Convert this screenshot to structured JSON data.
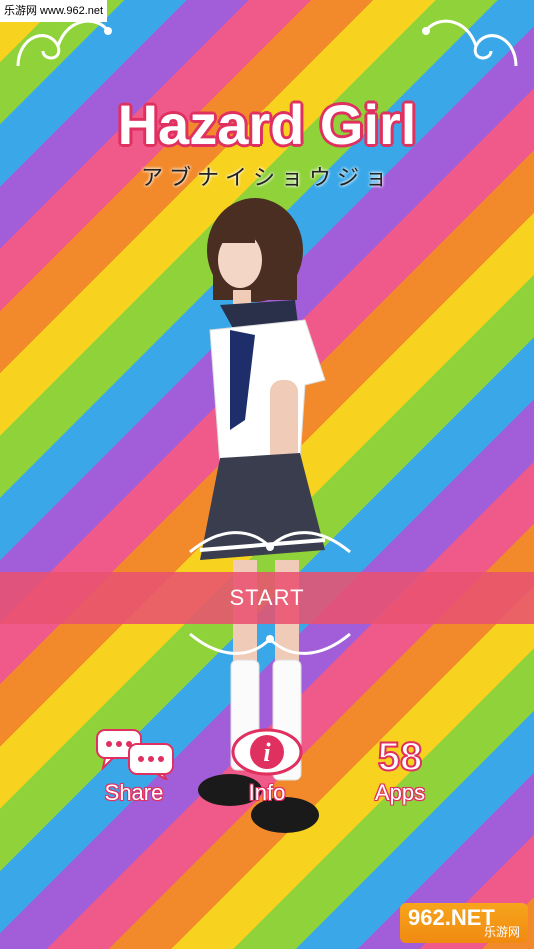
{
  "watermark": {
    "top_text": "乐游网 www.962.net",
    "badge_main": "962.NET",
    "badge_sub": "乐游网"
  },
  "header": {
    "title": "Hazard Girl",
    "subtitle": "アブナイショウジョ"
  },
  "start": {
    "label": "START"
  },
  "menu": {
    "share": {
      "label": "Share",
      "icon": "speech-bubbles-icon"
    },
    "info": {
      "label": "Info",
      "icon": "info-icon"
    },
    "apps": {
      "label": "Apps",
      "icon": "apps-58-icon",
      "icon_text": "58"
    }
  },
  "colors": {
    "accent": "#e03060",
    "stripes": [
      "#f7d21e",
      "#8fd23a",
      "#3aa8e8",
      "#a25ed8",
      "#f05a8a",
      "#f28a2c"
    ]
  }
}
